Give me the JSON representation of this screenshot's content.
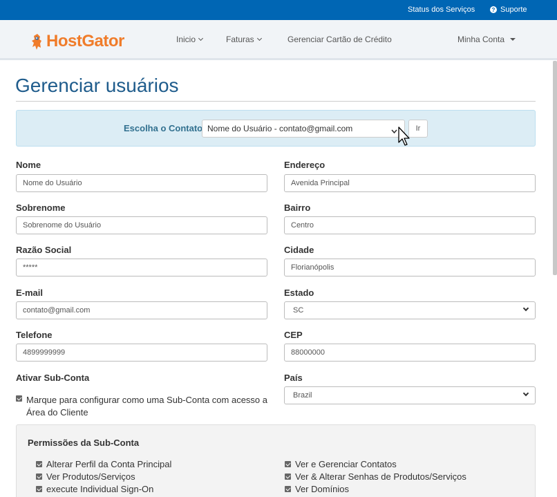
{
  "topbar": {
    "status_link": "Status dos Serviços",
    "support_link": "Suporte",
    "support_icon": "question-circle-icon"
  },
  "brand": {
    "logo_text": "HostGator",
    "color": "#f07c2a"
  },
  "nav": {
    "items": [
      {
        "label": "Inicio"
      },
      {
        "label": "Faturas"
      },
      {
        "label": "Gerenciar Cartão de Crédito"
      }
    ],
    "account": "Minha Conta"
  },
  "page": {
    "title": "Gerenciar usuários"
  },
  "contact": {
    "label": "Escolha o Contato",
    "selected": "Nome do Usuário - contato@gmail.com",
    "go_label": "Ir"
  },
  "form": {
    "nome": {
      "label": "Nome",
      "value": "Nome do Usuário"
    },
    "sobrenome": {
      "label": "Sobrenome",
      "value": "Sobrenome do Usuário"
    },
    "razao_social": {
      "label": "Razão Social",
      "value": "*****"
    },
    "email": {
      "label": "E-mail",
      "value": "contato@gmail.com"
    },
    "telefone": {
      "label": "Telefone",
      "value": "4899999999"
    },
    "endereco": {
      "label": "Endereço",
      "value": "Avenida Principal"
    },
    "bairro": {
      "label": "Bairro",
      "value": "Centro"
    },
    "cidade": {
      "label": "Cidade",
      "value": "Florianópolis"
    },
    "estado": {
      "label": "Estado",
      "value": "SC"
    },
    "cep": {
      "label": "CEP",
      "value": "88000000"
    },
    "pais": {
      "label": "País",
      "value": "Brazil"
    },
    "subconta": {
      "label": "Ativar Sub-Conta",
      "checkbox_text": "Marque para configurar como uma Sub-Conta com acesso a Área do Cliente",
      "checked": true
    }
  },
  "permissions": {
    "title": "Permissões da Sub-Conta",
    "left": [
      "Alterar Perfil da Conta Principal",
      "Ver Produtos/Serviços",
      "execute Individual Sign-On"
    ],
    "right": [
      "Ver e Gerenciar Contatos",
      "Ver & Alterar Senhas de Produtos/Serviços",
      "Ver Domínios"
    ]
  },
  "colors": {
    "topbar": "#0066b4",
    "title": "#1f5c8c",
    "contact_bg": "#dcedf5",
    "contact_label": "#31708f"
  }
}
